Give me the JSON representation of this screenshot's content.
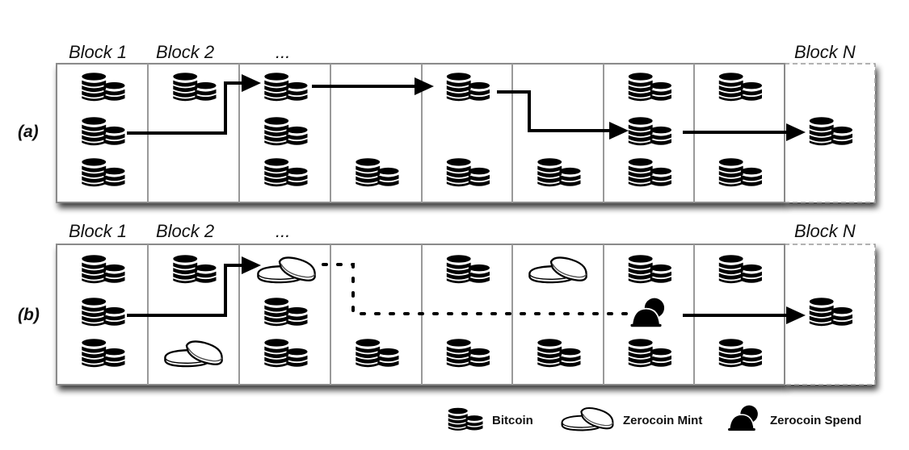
{
  "figure": {
    "description": "Blockchain transaction flow: (a) Bitcoin, (b) Zerocoin",
    "block_labels": [
      "Block 1",
      "Block 2",
      "...",
      "Block N"
    ],
    "num_blocks": 9,
    "last_block_dashed": true
  },
  "panels": [
    {
      "label": "(a)",
      "blocks": [
        {
          "slots": [
            "bitcoin",
            "bitcoin",
            "bitcoin"
          ]
        },
        {
          "slots": [
            "bitcoin",
            null,
            null
          ]
        },
        {
          "slots": [
            "bitcoin",
            "bitcoin",
            "bitcoin"
          ]
        },
        {
          "slots": [
            null,
            null,
            "bitcoin"
          ]
        },
        {
          "slots": [
            "bitcoin",
            null,
            "bitcoin"
          ]
        },
        {
          "slots": [
            null,
            null,
            "bitcoin"
          ]
        },
        {
          "slots": [
            "bitcoin",
            "bitcoin",
            "bitcoin"
          ]
        },
        {
          "slots": [
            "bitcoin",
            null,
            "bitcoin"
          ]
        },
        {
          "slots": [
            null,
            "bitcoin",
            null
          ]
        }
      ],
      "flows": [
        {
          "from": "block1-mid",
          "to": "block3-top",
          "style": "solid"
        },
        {
          "from": "block3-top",
          "to": "block5-top",
          "style": "solid"
        },
        {
          "from": "block5-top",
          "to": "block7-mid",
          "style": "solid"
        },
        {
          "from": "block7-mid",
          "to": "blockN-mid",
          "style": "solid"
        }
      ]
    },
    {
      "label": "(b)",
      "blocks": [
        {
          "slots": [
            "bitcoin",
            "bitcoin",
            "bitcoin"
          ]
        },
        {
          "slots": [
            "bitcoin",
            null,
            "mint"
          ]
        },
        {
          "slots": [
            "mint",
            "bitcoin",
            "bitcoin"
          ]
        },
        {
          "slots": [
            null,
            null,
            "bitcoin"
          ]
        },
        {
          "slots": [
            "bitcoin",
            null,
            "bitcoin"
          ]
        },
        {
          "slots": [
            "mint",
            null,
            "bitcoin"
          ]
        },
        {
          "slots": [
            "bitcoin",
            "spend",
            "bitcoin"
          ]
        },
        {
          "slots": [
            "bitcoin",
            null,
            "bitcoin"
          ]
        },
        {
          "slots": [
            null,
            "bitcoin",
            null
          ]
        }
      ],
      "flows": [
        {
          "from": "block1-mid",
          "to": "block3-top",
          "style": "solid"
        },
        {
          "from": "block3-top",
          "to": "block7-mid",
          "style": "dotted"
        },
        {
          "from": "block7-mid",
          "to": "blockN-mid",
          "style": "solid"
        }
      ]
    }
  ],
  "legend": [
    {
      "icon": "bitcoin",
      "label": "Bitcoin"
    },
    {
      "icon": "mint",
      "label": "Zerocoin Mint"
    },
    {
      "icon": "spend",
      "label": "Zerocoin Spend"
    }
  ],
  "colors": {
    "ink": "#000000",
    "divider": "#999999",
    "frame": "#8a8a8a",
    "shadow": "#555555"
  }
}
